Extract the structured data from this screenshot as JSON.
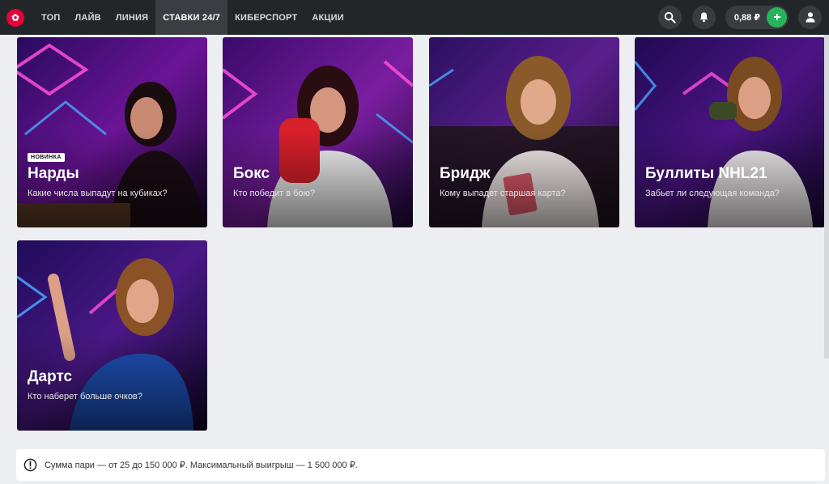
{
  "nav": {
    "items": [
      {
        "label": "ТОП"
      },
      {
        "label": "ЛАЙВ"
      },
      {
        "label": "ЛИНИЯ"
      },
      {
        "label": "СТАВКИ 24/7"
      },
      {
        "label": "КИБЕРСПОРТ"
      },
      {
        "label": "АКЦИИ"
      }
    ],
    "active": "СТАВКИ 24/7"
  },
  "header": {
    "balance": "0,88 ₽",
    "icons": [
      "search-icon",
      "bell-icon",
      "plus-icon",
      "user-icon"
    ]
  },
  "tiles": [
    {
      "badge": "НОВИНКА",
      "title": "Нарды",
      "subtitle": "Какие числа выпадут на кубиках?"
    },
    {
      "title": "Бокс",
      "subtitle": "Кто победит в бою?"
    },
    {
      "title": "Бридж",
      "subtitle": "Кому выпадет старшая карта?"
    },
    {
      "title": "Буллиты NHL21",
      "subtitle": "Забьет ли следующая команда?"
    },
    {
      "title": "Дартс",
      "subtitle": "Кто наберет больше очков?"
    }
  ],
  "info": {
    "text": "Сумма пари — от 25 до 150 000 ₽. Максимальный выигрыш — 1 500 000 ₽."
  },
  "colors": {
    "header_bg": "#232629",
    "accent_red": "#e4003a",
    "accent_green": "#27b35a",
    "page_bg": "#eceef1"
  }
}
